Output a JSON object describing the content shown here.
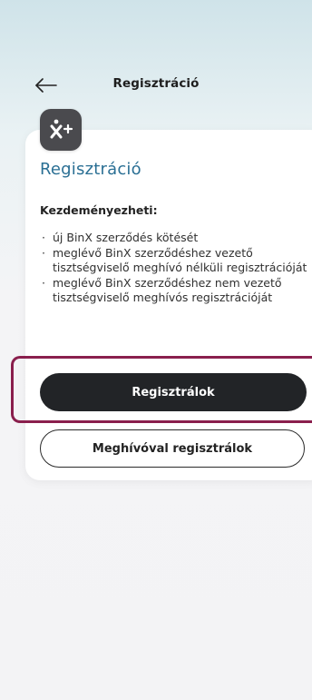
{
  "header": {
    "title": "Regisztráció",
    "back_icon": "arrow-left-icon"
  },
  "card": {
    "badge_icon": "user-plus-icon",
    "badge_text": "ẋ+",
    "title": "Regisztráció",
    "subtitle": "Kezdeményezheti:",
    "bullets": [
      "új BinX szerződés kötését",
      "meglévő BinX szerződéshez vezető tisztségviselő meghívó nélküli regisztrációját",
      "meglévő BinX szerződéshez nem vezető tisztségviselő meghívós regisztrációját"
    ],
    "primary_button": "Regisztrálok",
    "secondary_button": "Meghívóval regisztrálok"
  },
  "colors": {
    "accent_title": "#2a6f94",
    "primary_button_bg": "#222427",
    "highlight_border": "#8a1f4d",
    "badge_bg": "#4a4a4e"
  }
}
